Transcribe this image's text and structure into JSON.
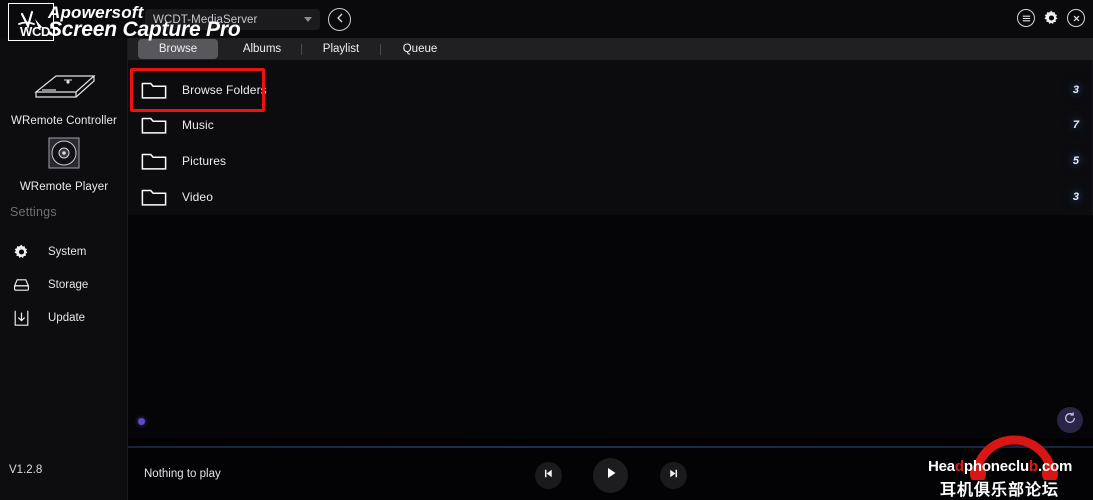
{
  "window": {
    "controls": [
      {
        "name": "menu-icon",
        "label": "menu"
      },
      {
        "name": "settings-icon",
        "label": "settings"
      },
      {
        "name": "close-icon",
        "label": "close"
      }
    ]
  },
  "topbar": {
    "server_name": "WCDT-MediaServer",
    "back_label": "back"
  },
  "tabs": [
    {
      "label": "Browse",
      "active": true
    },
    {
      "label": "Albums",
      "active": false
    },
    {
      "label": "Playlist",
      "active": false
    },
    {
      "label": "Queue",
      "active": false
    }
  ],
  "sidebar": {
    "devices": [
      {
        "label": "WRemote Controller",
        "icon": "device-box-icon"
      },
      {
        "label": "WRemote Player",
        "icon": "disc-player-icon"
      }
    ],
    "settings_header": "Settings",
    "items": [
      {
        "label": "System",
        "icon": "gear-icon"
      },
      {
        "label": "Storage",
        "icon": "drive-icon"
      },
      {
        "label": "Update",
        "icon": "download-icon"
      }
    ],
    "version": "V1.2.8"
  },
  "browse_list": [
    {
      "label": "Browse Folders",
      "count": "3",
      "highlighted": true
    },
    {
      "label": "Music",
      "count": "7",
      "highlighted": false
    },
    {
      "label": "Pictures",
      "count": "5",
      "highlighted": false
    },
    {
      "label": "Video",
      "count": "3",
      "highlighted": false
    }
  ],
  "content": {
    "refresh_label": "refresh"
  },
  "player": {
    "now_playing": "Nothing to play",
    "prev_label": "previous",
    "play_label": "play",
    "next_label": "next"
  },
  "watermarks": {
    "apowersoft_line1": "Apowersoft",
    "apowersoft_line2": "Screen Capture Pro",
    "apowersoft_logo": "WCDT",
    "headphoneclub_part1": "Hea",
    "headphoneclub_part2": "d",
    "headphoneclub_part3": "phoneclu",
    "headphoneclub_part4": "b",
    "headphoneclub_part5": ".com",
    "headphoneclub_cn": "耳机俱乐部论坛"
  },
  "colors": {
    "accent_blue": "#2a4a9c",
    "highlight_red": "#ee1111",
    "purple": "#5b4bc4",
    "watermark_red": "#e01a1a"
  }
}
